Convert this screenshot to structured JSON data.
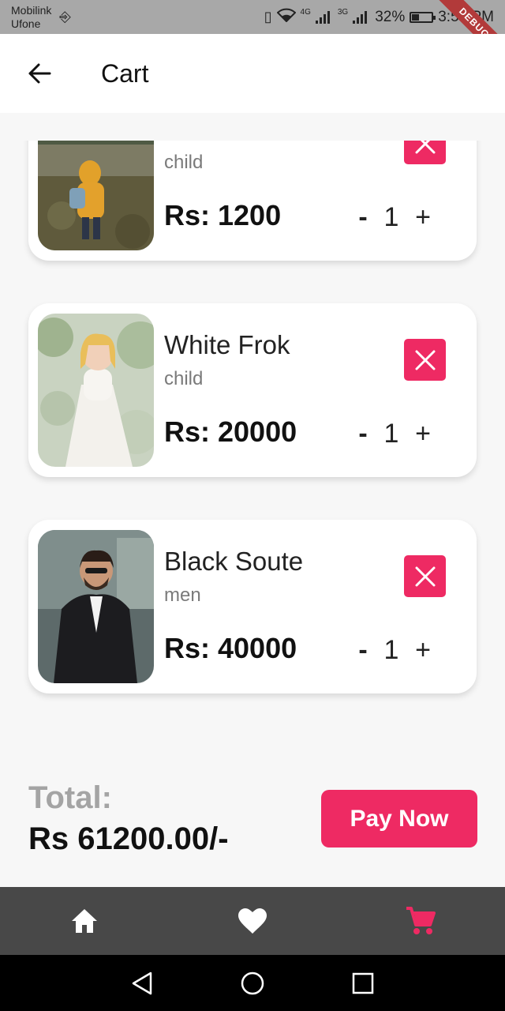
{
  "status_bar": {
    "carrier1": "Mobilink",
    "carrier2": "Ufone",
    "net1": "4G",
    "net2": "3G",
    "battery": "32%",
    "time": "3:53 PM",
    "debug_label": "DEBUG"
  },
  "app_bar": {
    "title": "Cart",
    "back_icon": "arrow-left-icon"
  },
  "cart_items": [
    {
      "name": "",
      "category": "child",
      "price": "Rs: 1200",
      "qty": "1",
      "minus": "-",
      "plus": "+",
      "image": "child-yellow-raincoat-photo"
    },
    {
      "name": "White Frok",
      "category": "child",
      "price": "Rs: 20000",
      "qty": "1",
      "minus": "-",
      "plus": "+",
      "image": "child-white-dress-photo"
    },
    {
      "name": "Black Soute",
      "category": "men",
      "price": "Rs: 40000",
      "qty": "1",
      "minus": "-",
      "plus": "+",
      "image": "man-black-suit-photo"
    }
  ],
  "summary": {
    "total_label": "Total:",
    "total_value": "Rs 61200.00/-",
    "pay_label": "Pay Now"
  },
  "bottom_nav": {
    "items": [
      {
        "icon": "home-icon",
        "active": false
      },
      {
        "icon": "heart-icon",
        "active": false
      },
      {
        "icon": "cart-icon",
        "active": true
      }
    ]
  },
  "colors": {
    "accent": "#ee2a63",
    "nav_bg": "#484848",
    "nav_icon": "#ffffff"
  }
}
